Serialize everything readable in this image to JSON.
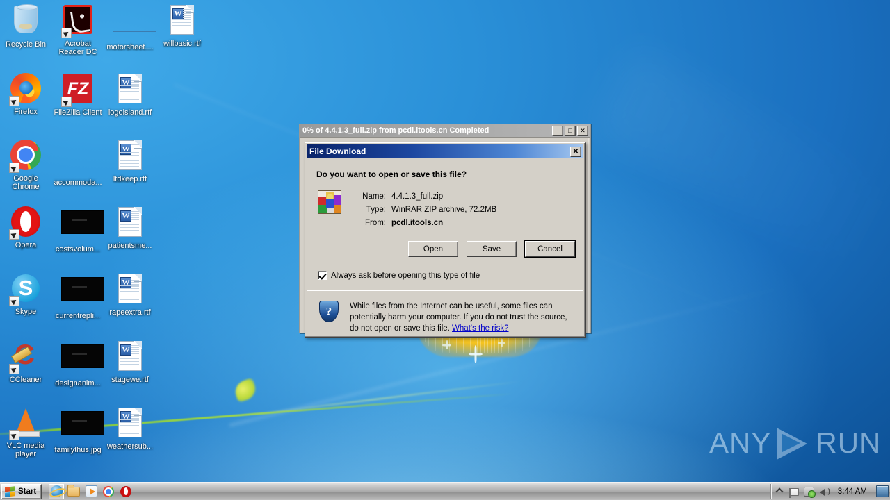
{
  "desktop": {
    "icons": [
      {
        "label": "Recycle Bin",
        "art": "recycle",
        "shortcut": false,
        "col": 0,
        "row": 0
      },
      {
        "label": "Acrobat Reader DC",
        "art": "pdf",
        "shortcut": true,
        "col": 1,
        "row": 0
      },
      {
        "label": "motorsheet....",
        "art": "outline",
        "shortcut": false,
        "col": 2,
        "row": 0
      },
      {
        "label": "willbasic.rtf",
        "art": "word",
        "shortcut": false,
        "col": 3,
        "row": 0
      },
      {
        "label": "Firefox",
        "art": "firefox",
        "shortcut": true,
        "col": 0,
        "row": 1
      },
      {
        "label": "FileZilla Client",
        "art": "fz",
        "shortcut": true,
        "col": 1,
        "row": 1
      },
      {
        "label": "logoisland.rtf",
        "art": "word",
        "shortcut": false,
        "col": 2,
        "row": 1
      },
      {
        "label": "Google Chrome",
        "art": "chrome",
        "shortcut": true,
        "col": 0,
        "row": 2
      },
      {
        "label": "accommoda...",
        "art": "outline",
        "shortcut": false,
        "col": 1,
        "row": 2
      },
      {
        "label": "ltdkeep.rtf",
        "art": "word",
        "shortcut": false,
        "col": 2,
        "row": 2
      },
      {
        "label": "Opera",
        "art": "opera",
        "shortcut": true,
        "col": 0,
        "row": 3
      },
      {
        "label": "costsvolum...",
        "art": "black",
        "shortcut": false,
        "col": 1,
        "row": 3
      },
      {
        "label": "patientsme...",
        "art": "word",
        "shortcut": false,
        "col": 2,
        "row": 3
      },
      {
        "label": "Skype",
        "art": "skype",
        "shortcut": true,
        "col": 0,
        "row": 4
      },
      {
        "label": "currentrepli...",
        "art": "black",
        "shortcut": false,
        "col": 1,
        "row": 4
      },
      {
        "label": "rapeextra.rtf",
        "art": "word",
        "shortcut": false,
        "col": 2,
        "row": 4
      },
      {
        "label": "CCleaner",
        "art": "ccleaner",
        "shortcut": true,
        "col": 0,
        "row": 5
      },
      {
        "label": "designanim...",
        "art": "black",
        "shortcut": false,
        "col": 1,
        "row": 5
      },
      {
        "label": "stagewe.rtf",
        "art": "word",
        "shortcut": false,
        "col": 2,
        "row": 5
      },
      {
        "label": "VLC media player",
        "art": "vlc",
        "shortcut": true,
        "col": 0,
        "row": 6
      },
      {
        "label": "familythus.jpg",
        "art": "black",
        "shortcut": false,
        "col": 1,
        "row": 6
      },
      {
        "label": "weathersub...",
        "art": "word",
        "shortcut": false,
        "col": 2,
        "row": 6
      }
    ]
  },
  "download_window": {
    "title": "0% of 4.4.1.3_full.zip from pcdl.itools.cn Completed",
    "minimize_glyph": "_",
    "maximize_glyph": "□",
    "close_glyph": "✕"
  },
  "file_download_dialog": {
    "title": "File Download",
    "close_glyph": "✕",
    "question": "Do you want to open or save this file?",
    "file_icon": "winrar-archive-icon",
    "fields": [
      {
        "key": "Name:",
        "value": "4.4.1.3_full.zip",
        "bold": false
      },
      {
        "key": "Type:",
        "value": "WinRAR ZIP archive, 72.2MB",
        "bold": false
      },
      {
        "key": "From:",
        "value": "pcdl.itools.cn",
        "bold": true
      }
    ],
    "buttons": [
      {
        "label": "Open",
        "default": false
      },
      {
        "label": "Save",
        "default": false
      },
      {
        "label": "Cancel",
        "default": true
      }
    ],
    "checkbox": {
      "label": "Always ask before opening this type of file",
      "checked": true
    },
    "warning": {
      "icon": "shield-question-icon",
      "text": "While files from the Internet can be useful, some files can potentially harm your computer. If you do not trust the source, do not open or save this file. ",
      "link": "What's the risk?"
    }
  },
  "watermark": {
    "text_left": "ANY",
    "text_right": "RUN"
  },
  "taskbar": {
    "start_label": "Start",
    "quicklaunch": [
      {
        "name": "internet-explorer",
        "active": true
      },
      {
        "name": "windows-explorer",
        "active": false
      },
      {
        "name": "windows-media-player",
        "active": false
      },
      {
        "name": "google-chrome",
        "active": false
      },
      {
        "name": "opera",
        "active": false
      }
    ],
    "tray": {
      "chevron": "show-hidden-icons",
      "flag": "action-center-icon",
      "network": "network-icon",
      "volume": "volume-icon",
      "clock": "3:44 AM",
      "show_desktop": "show-desktop-button"
    }
  },
  "colors": {
    "dialog_face": "#d4d0c8",
    "titlebar_active_start": "#0a246a",
    "titlebar_active_end": "#a6c8f0",
    "titlebar_inactive": "#a7a7a7",
    "link": "#0000c8",
    "desktop_blue": "#1f7ec9"
  }
}
